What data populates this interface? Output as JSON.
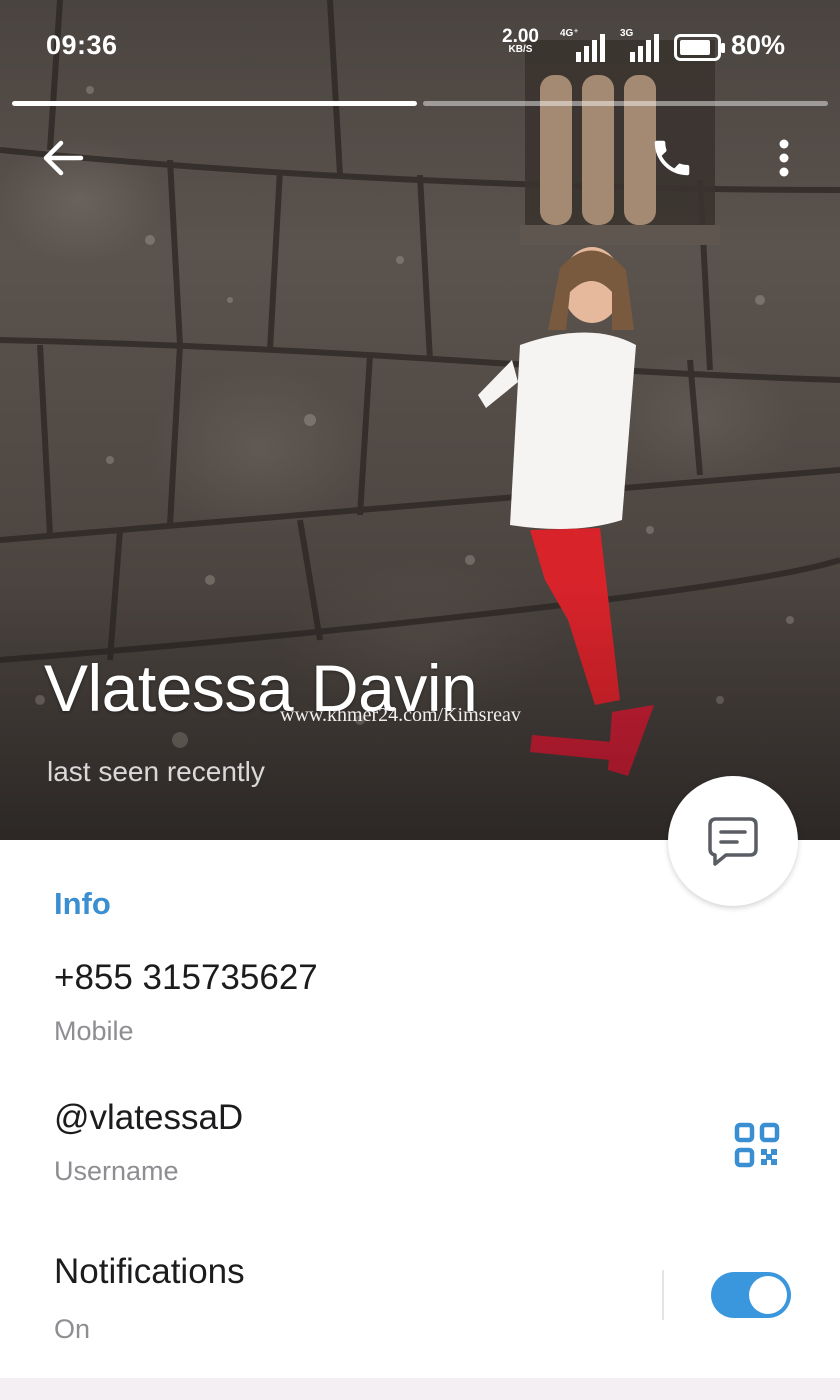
{
  "status_bar": {
    "time": "09:36",
    "speed_value": "2.00",
    "speed_unit": "KB/S",
    "network_1": "4G⁺",
    "network_2": "3G",
    "battery_percent": "80%"
  },
  "story_progress": {
    "segments": 2,
    "active_index": 0
  },
  "header": {
    "back_icon": "arrow-left-icon",
    "call_icon": "phone-icon",
    "menu_icon": "more-vertical-icon"
  },
  "profile": {
    "name": "Vlatessa Davin",
    "status": "last seen recently",
    "watermark": "www.khmer24.com/Kimsreav"
  },
  "fab": {
    "icon": "message-icon"
  },
  "info": {
    "section_title": "Info",
    "phone": {
      "value": "+855 315735627",
      "label": "Mobile"
    },
    "username": {
      "value": "@vlatessaD",
      "label": "Username",
      "icon": "qr-code-icon"
    },
    "notifications": {
      "value": "Notifications",
      "label": "On",
      "enabled": true
    }
  },
  "colors": {
    "accent": "#3a8fd3",
    "toggle_on": "#3b97dd",
    "label_gray": "#8d8d92"
  }
}
